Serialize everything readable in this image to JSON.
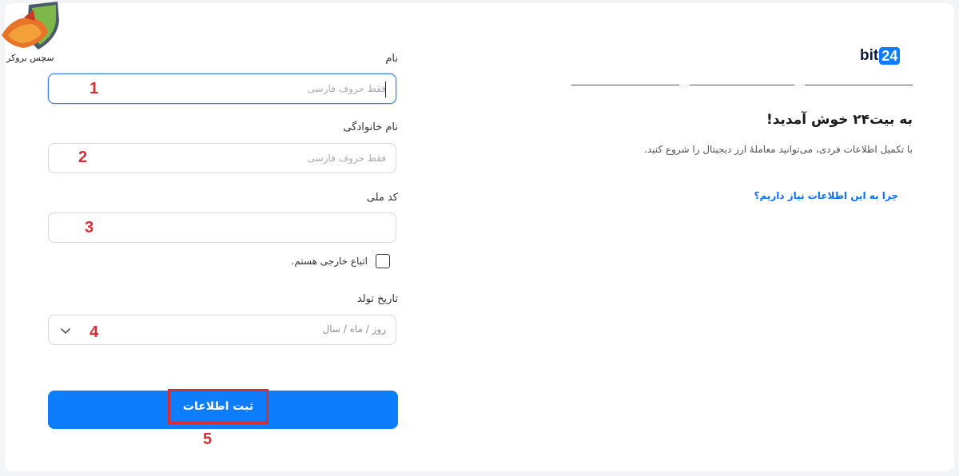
{
  "watermark": {
    "text": "سچس بروکر"
  },
  "form": {
    "first_name": {
      "label": "نام",
      "placeholder": "فقط حروف فارسی",
      "annotation": "1"
    },
    "last_name": {
      "label": "نام خانوادگی",
      "placeholder": "فقط حروف فارسی",
      "annotation": "2"
    },
    "national_code": {
      "label": "کد ملی",
      "placeholder": "",
      "annotation": "3"
    },
    "foreign_national": {
      "label": "اتباع خارجی هستم.",
      "checked": false
    },
    "birth_date": {
      "label": "تاریخ تولد",
      "placeholder": "روز / ماه / سال",
      "annotation": "4"
    },
    "submit": {
      "label": "ثبت اطلاعات",
      "annotation": "5"
    }
  },
  "brand": {
    "logo_text": "bit",
    "logo_number": "24",
    "accent": "#0d7dfc",
    "highlight": "#d92d34"
  },
  "steps": {
    "count": 3
  },
  "welcome": {
    "title": "به بیت۲۴ خوش آمدید!",
    "subtitle": "با تکمیل اطلاعات فردی، می‌توانید معاملهٔ ارز دیجیتال را شروع کنید.",
    "link": "چرا به این اطلاعات نیاز داریم؟"
  }
}
